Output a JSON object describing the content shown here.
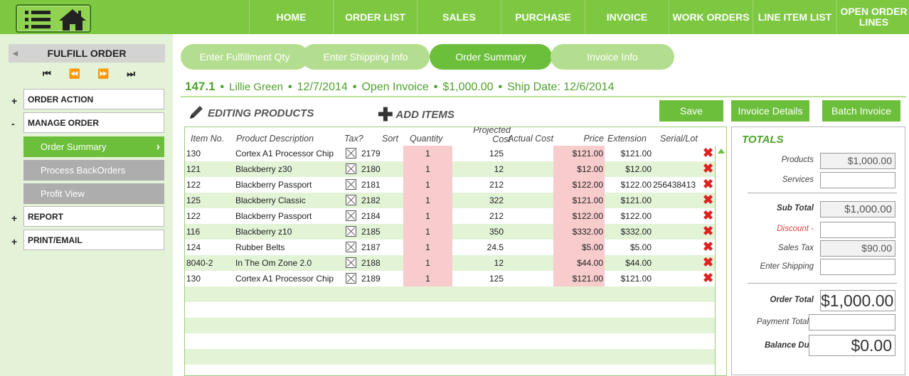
{
  "nav": [
    "HOME",
    "ORDER LIST",
    "SALES",
    "PURCHASE",
    "INVOICE",
    "WORK ORDERS",
    "LINE ITEM LIST",
    "OPEN ORDER LINES"
  ],
  "sidebar": {
    "title": "FULFILL ORDER",
    "sections": [
      {
        "toggle": "+",
        "label": "ORDER ACTION"
      },
      {
        "toggle": "-",
        "label": "MANAGE ORDER"
      },
      {
        "toggle": "+",
        "label": "REPORT"
      },
      {
        "toggle": "+",
        "label": "PRINT/EMAIL"
      }
    ],
    "subitems": [
      {
        "label": "Order Summary",
        "active": true
      },
      {
        "label": "Process BackOrders",
        "active": false
      },
      {
        "label": "Profit View",
        "active": false
      }
    ]
  },
  "steps": [
    "Enter Fulfillment Qty",
    "Enter Shipping Info",
    "Order Summary",
    "Invoice Info"
  ],
  "order": {
    "number": "147.1",
    "customer": "Lillie Green",
    "date": "12/7/2014",
    "status": "Open Invoice",
    "amount": "$1,000.00",
    "ship": "Ship Date: 12/6/2014"
  },
  "toolbar": {
    "editing": "EDITING PRODUCTS",
    "add": "ADD ITEMS",
    "save": "Save",
    "invoice_details": "Invoice Details",
    "batch_invoice": "Batch Invoice"
  },
  "table": {
    "headers": {
      "item": "Item No.",
      "desc": "Product Description",
      "tax": "Tax?",
      "sort": "Sort",
      "qty": "Quantity",
      "proj1": "Projected",
      "proj2": "Cost",
      "actual": "Actual Cost",
      "price": "Price",
      "ext": "Extension",
      "serial": "Serial/Lot"
    },
    "rows": [
      {
        "item": "130",
        "desc": "Cortex A1 Processor Chip",
        "sort": "2179",
        "qty": "1",
        "proj": "125",
        "price": "$121.00",
        "ext": "$121.00",
        "serial": ""
      },
      {
        "item": "121",
        "desc": "Blackberry z30",
        "sort": "2180",
        "qty": "1",
        "proj": "12",
        "price": "$12.00",
        "ext": "$12.00",
        "serial": ""
      },
      {
        "item": "122",
        "desc": "Blackberry Passport",
        "sort": "2181",
        "qty": "1",
        "proj": "212",
        "price": "$122.00",
        "ext": "$122.00",
        "serial": "256438413"
      },
      {
        "item": "125",
        "desc": "Blackberry Classic",
        "sort": "2182",
        "qty": "1",
        "proj": "322",
        "price": "$121.00",
        "ext": "$121.00",
        "serial": ""
      },
      {
        "item": "122",
        "desc": "Blackberry Passport",
        "sort": "2184",
        "qty": "1",
        "proj": "212",
        "price": "$122.00",
        "ext": "$122.00",
        "serial": ""
      },
      {
        "item": "116",
        "desc": "Blackberry z10",
        "sort": "2185",
        "qty": "1",
        "proj": "350",
        "price": "$332.00",
        "ext": "$332.00",
        "serial": ""
      },
      {
        "item": "124",
        "desc": "Rubber Belts",
        "sort": "2187",
        "qty": "1",
        "proj": "24.5",
        "price": "$5.00",
        "ext": "$5.00",
        "serial": ""
      },
      {
        "item": "8040-2",
        "desc": "In The Om Zone 2.0",
        "sort": "2188",
        "qty": "1",
        "proj": "12",
        "price": "$44.00",
        "ext": "$44.00",
        "serial": ""
      },
      {
        "item": "130",
        "desc": "Cortex A1 Processor Chip",
        "sort": "2189",
        "qty": "1",
        "proj": "125",
        "price": "$121.00",
        "ext": "$121.00",
        "serial": ""
      }
    ],
    "empty_rows": 6
  },
  "totals": {
    "title": "TOTALS",
    "products_label": "Products",
    "products": "$1,000.00",
    "services_label": "Services",
    "services": "",
    "subtotal_label": "Sub Total",
    "subtotal": "$1,000.00",
    "discount_label": "Discount -",
    "discount": "",
    "tax_label": "Sales Tax",
    "tax": "$90.00",
    "shipping_label": "Enter Shipping",
    "shipping": "",
    "order_total_label": "Order Total",
    "order_total": "$1,000.00",
    "payment_label": "Payment Total",
    "payment": "",
    "balance_label": "Balance Due",
    "balance": "$0.00"
  },
  "colors": {
    "brand_green": "#7dc840",
    "accent_green": "#6cbf3a",
    "text_green": "#4ea22c",
    "pink": "#f8cccc",
    "delete_red": "#e02020"
  }
}
